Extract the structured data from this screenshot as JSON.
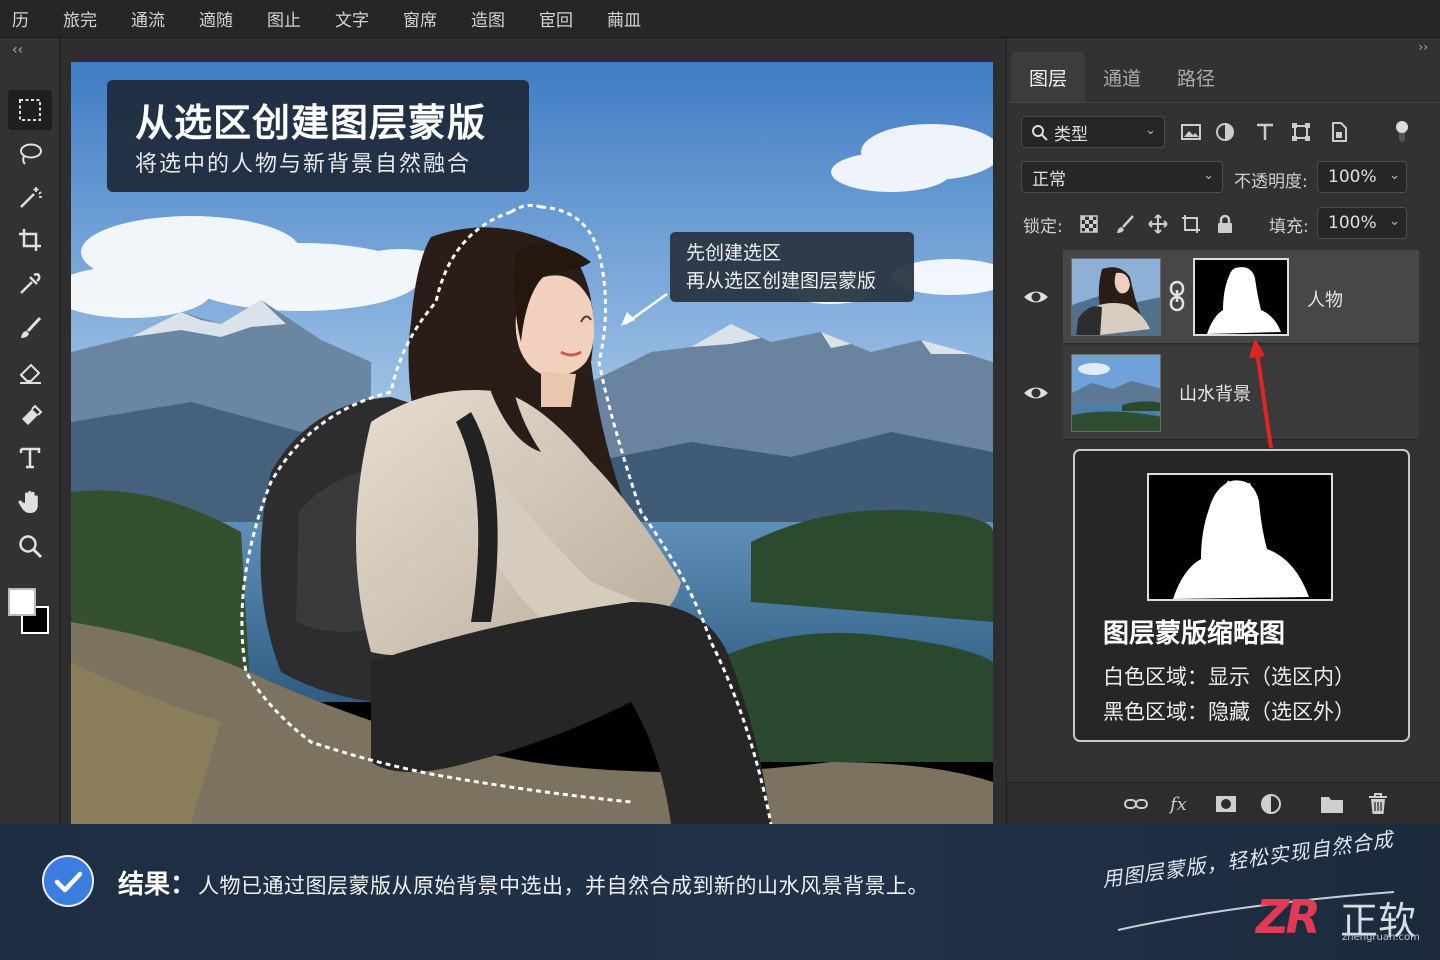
{
  "menu": [
    "历",
    "旅完",
    "通流",
    "適随",
    "图止",
    "文字",
    "窗席",
    "造图",
    "宦回",
    "繭皿"
  ],
  "toolbar": {
    "collapse_glyph": "‹‹",
    "tools": [
      "marquee-tool",
      "lasso-tool",
      "magic-wand-tool",
      "crop-tool",
      "eyedropper-tool",
      "brush-tool",
      "eraser-tool",
      "paint-bucket-tool",
      "type-tool",
      "hand-tool",
      "zoom-tool"
    ],
    "foreground_color": "#ffffff",
    "background_color": "#000000"
  },
  "canvas": {
    "title": "从选区创建图层蒙版",
    "subtitle": "将选中的人物与新背景自然融合",
    "callout_line1": "先创建选区",
    "callout_line2": "再从选区创建图层蒙版"
  },
  "panel": {
    "collapse_glyph": "››",
    "tabs": [
      "图层",
      "通道",
      "路径"
    ],
    "filter_label": "类型",
    "blend_mode": "正常",
    "opacity_label": "不透明度:",
    "opacity_value": "100%",
    "lock_label": "锁定:",
    "fill_label": "填充:",
    "fill_value": "100%",
    "layers": [
      {
        "name": "人物",
        "visible": true,
        "has_mask": true,
        "selected": true
      },
      {
        "name": "山水背景",
        "visible": true,
        "has_mask": false,
        "selected": false
      }
    ],
    "mask_card": {
      "title": "图层蒙版缩略图",
      "line1": "白色区域：显示（选区内）",
      "line2": "黑色区域：隐藏（选区外）"
    },
    "bottom_icons": [
      "link-icon",
      "fx-icon",
      "add-mask-icon",
      "adjustment-icon",
      "folder-icon",
      "trash-icon"
    ]
  },
  "result": {
    "label": "结果：",
    "text": "人物已通过图层蒙版从原始背景中选出，并自然合成到新的山水风景背景上。",
    "slogan": "用图层蒙版，轻松实现自然合成",
    "logo_mark": "ZR",
    "logo_text": "正软",
    "logo_url": "zhengruan.com"
  },
  "colors": {
    "accent_blue": "#3c7ee0",
    "arrow_red": "#e02424",
    "logo_red": "#e23a55"
  }
}
